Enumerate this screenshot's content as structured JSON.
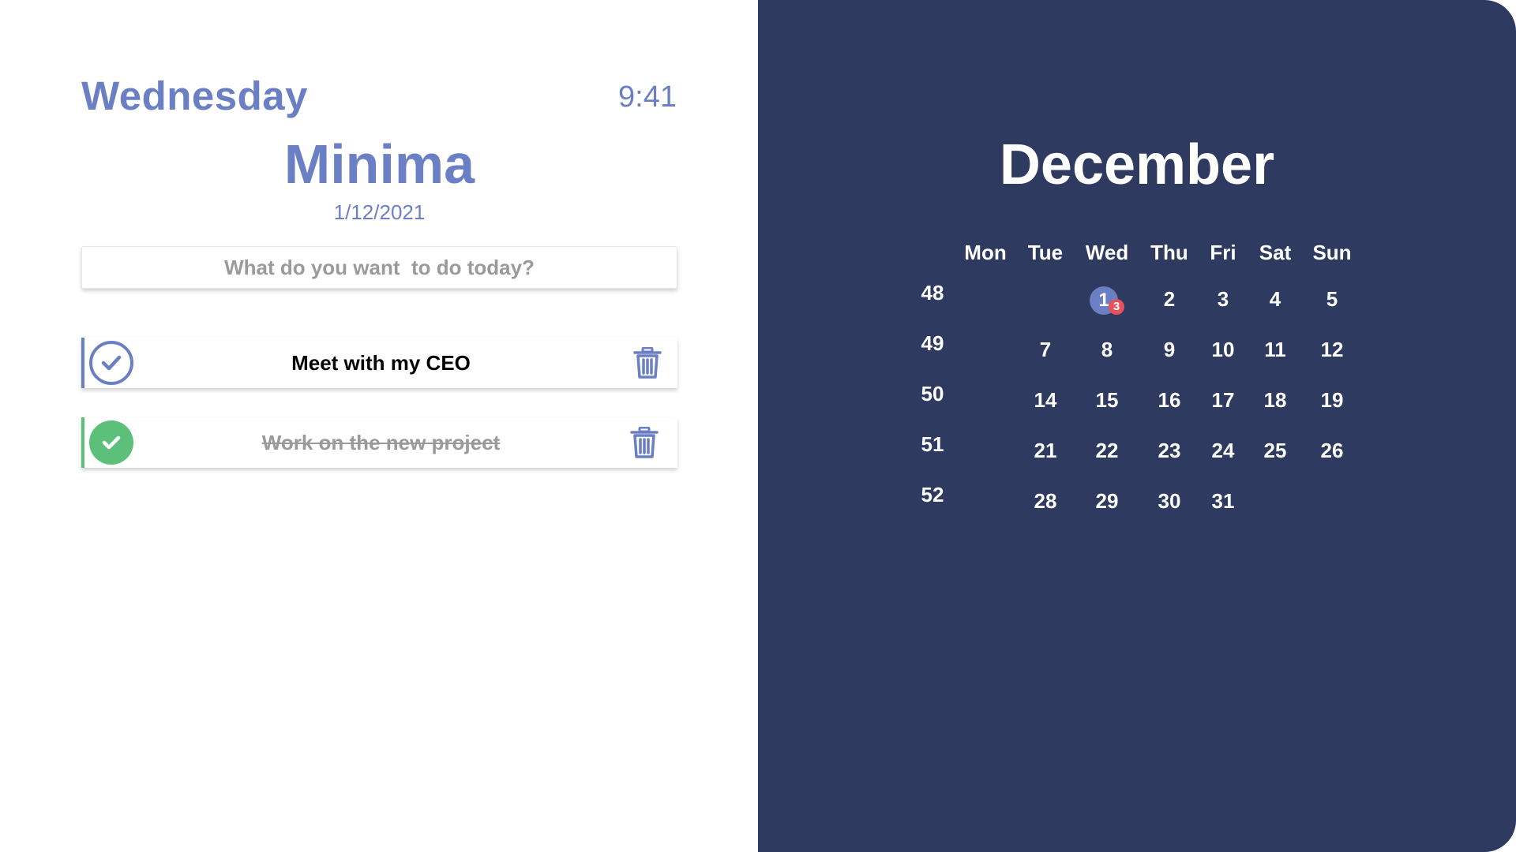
{
  "header": {
    "day_name": "Wednesday",
    "time": "9:41",
    "app_title": "Minima",
    "date": "1/12/2021"
  },
  "input": {
    "placeholder": "What do you want  to do today?"
  },
  "tasks": [
    {
      "text": "Meet with my CEO",
      "done": false
    },
    {
      "text": "Work on the new project",
      "done": true
    }
  ],
  "calendar": {
    "month": "December",
    "weekdays": [
      "Mon",
      "Tue",
      "Wed",
      "Thu",
      "Fri",
      "Sat",
      "Sun"
    ],
    "weeks": [
      {
        "week": "48",
        "days": [
          "",
          "",
          "1",
          "2",
          "3",
          "4",
          "5"
        ]
      },
      {
        "week": "49",
        "days": [
          "",
          "7",
          "8",
          "9",
          "10",
          "11",
          "12"
        ]
      },
      {
        "week": "50",
        "days": [
          "",
          "14",
          "15",
          "16",
          "17",
          "18",
          "19"
        ]
      },
      {
        "week": "51",
        "days": [
          "",
          "21",
          "22",
          "23",
          "24",
          "25",
          "26"
        ]
      },
      {
        "week": "52",
        "days": [
          "",
          "28",
          "29",
          "30",
          "31",
          "",
          ""
        ]
      }
    ],
    "today": "1",
    "today_badge": "3"
  },
  "colors": {
    "accent": "#6b7fc4",
    "panel": "#2f3a60",
    "done": "#5cc07a",
    "badge": "#e8505b"
  },
  "icons": {
    "check_open": "check-circle-outline-icon",
    "check_done": "check-circle-filled-icon",
    "delete": "trash-icon"
  }
}
